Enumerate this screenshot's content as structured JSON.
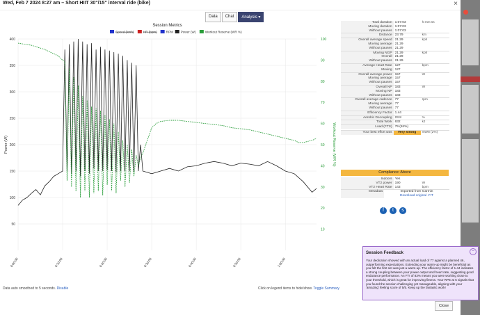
{
  "window": {
    "title": "Wed, Feb 7 2024 8:27 am – Short HIIT 30\"/15\" interval ride (bike)",
    "close_glyph": "×",
    "tabs": [
      {
        "label": "Data",
        "active": false
      },
      {
        "label": "Chat",
        "active": false
      },
      {
        "label": "Analysis ▾",
        "active": true
      }
    ]
  },
  "chart_data": {
    "type": "line",
    "title": "Session Metrics",
    "legend": [
      {
        "name": "Speed (kmh)",
        "color": "#2233cc",
        "hidden": true
      },
      {
        "name": "HR (bpm)",
        "color": "#cc2222",
        "hidden": true
      },
      {
        "name": "RPM",
        "color": "#2233cc",
        "hidden": false
      },
      {
        "name": "Power (W)",
        "color": "#222222",
        "hidden": false
      },
      {
        "name": "Workout Reserve (WR %)",
        "color": "#2a9d3a",
        "hidden": false
      }
    ],
    "legend_placement": "top",
    "ylabel_left": "Power (W)",
    "ylabel_right": "Workout Reserve (WR %)",
    "ylim_left": [
      0,
      400
    ],
    "ylim_right": [
      0,
      100
    ],
    "yticks_left": [
      50,
      100,
      150,
      200,
      250,
      300,
      350,
      400
    ],
    "yticks_right": [
      10,
      20,
      30,
      40,
      50,
      60,
      70,
      80,
      90,
      100
    ],
    "xticks": [
      "0:00:00",
      "0:10:00",
      "0:20:00",
      "0:30:00",
      "0:40:00",
      "0:50:00",
      "1:00:00"
    ],
    "xlim_minutes": [
      0,
      67
    ],
    "grid": true,
    "series": [
      {
        "name": "Power (W)",
        "x": [
          0,
          1,
          2,
          3,
          4,
          5,
          6,
          7,
          8,
          9,
          10,
          10.5,
          11,
          11.5,
          12,
          12.5,
          13,
          13.5,
          14,
          14.5,
          15,
          15.5,
          16,
          16.5,
          17,
          17.5,
          18,
          18.5,
          19,
          19.5,
          20,
          20.5,
          21,
          21.5,
          22,
          22.5,
          23,
          23.5,
          24,
          24.5,
          25,
          25.5,
          26,
          26.5,
          27,
          27.5,
          28,
          30,
          32,
          34,
          36,
          38,
          40,
          42,
          44,
          46,
          48,
          50,
          52,
          54,
          56,
          58,
          60,
          62,
          64,
          66,
          67
        ],
        "values": [
          85,
          95,
          100,
          108,
          115,
          105,
          122,
          130,
          140,
          145,
          150,
          380,
          150,
          390,
          145,
          395,
          150,
          400,
          140,
          395,
          150,
          390,
          145,
          392,
          155,
          380,
          150,
          385,
          150,
          380,
          152,
          378,
          150,
          375,
          148,
          372,
          150,
          368,
          150,
          360,
          150,
          355,
          148,
          350,
          150,
          200,
          150,
          145,
          150,
          155,
          150,
          158,
          160,
          165,
          168,
          165,
          160,
          165,
          163,
          160,
          168,
          160,
          150,
          145,
          130,
          110,
          117
        ]
      },
      {
        "name": "Workout Reserve (WR %)",
        "x": [
          0,
          3,
          6,
          9,
          10,
          10.5,
          11,
          11.5,
          12,
          12.5,
          13,
          13.5,
          14,
          14.5,
          15,
          15.5,
          16,
          16.5,
          17,
          17.5,
          18,
          18.5,
          19,
          19.5,
          20,
          20.5,
          21,
          21.5,
          22,
          22.5,
          23,
          23.5,
          24,
          24.5,
          25,
          25.5,
          26,
          26.5,
          27,
          27.5,
          28,
          29,
          30,
          31,
          32,
          34,
          36,
          38,
          40,
          42,
          44,
          46,
          48,
          50,
          52,
          54,
          56,
          58,
          60,
          62,
          63,
          64,
          66,
          67
        ],
        "values": [
          98,
          97,
          95,
          92,
          90,
          89,
          33,
          86,
          30,
          82,
          28,
          78,
          25,
          73,
          28,
          71,
          25,
          68,
          27,
          67,
          28,
          66,
          26,
          64,
          31,
          62,
          28,
          60,
          27,
          56,
          33,
          52,
          30,
          50,
          32,
          48,
          35,
          45,
          40,
          44,
          46,
          52,
          58,
          60,
          61,
          61.5,
          61.5,
          61,
          60.5,
          60,
          59.5,
          59,
          58,
          57.5,
          57,
          56,
          55,
          54,
          53,
          52,
          51,
          51,
          52,
          53
        ]
      }
    ]
  },
  "footnote": {
    "text": "Data auto smoothed to 5 seconds.",
    "link": "Disable"
  },
  "toggle_hint": {
    "text": "Click on legend items to hide/show.",
    "link": "Toggle Summary"
  },
  "metrics": {
    "rows": [
      {
        "label": "Total duration",
        "value": "1:07:03",
        "unit": "h:mm:ss"
      },
      {
        "label": "Moving duration",
        "value": "1:07:03",
        "unit": ""
      },
      {
        "label": "Without pauses",
        "value": "1:07:03",
        "unit": ""
      },
      {
        "label": "Distance",
        "value": "23.79",
        "unit": "km",
        "sep": true
      },
      {
        "label": "Overall average speed",
        "value": "21.29",
        "unit": "kph",
        "sep": true
      },
      {
        "label": "Moving average",
        "value": "21.29",
        "unit": ""
      },
      {
        "label": "Without pauses",
        "value": "21.29",
        "unit": ""
      },
      {
        "label": "Moving NGP",
        "value": "21.29",
        "unit": "kph",
        "sep": true
      },
      {
        "label": "Overall",
        "value": "21.29",
        "unit": ""
      },
      {
        "label": "Without pauses",
        "value": "21.29",
        "unit": ""
      },
      {
        "label": "Average Heart Rate",
        "value": "127",
        "unit": "bpm",
        "sep": true
      },
      {
        "label": "Moving",
        "value": "127",
        "unit": ""
      },
      {
        "label": "Overall average power",
        "value": "157",
        "unit": "W",
        "sep": true
      },
      {
        "label": "Moving average",
        "value": "157",
        "unit": ""
      },
      {
        "label": "Without pauses",
        "value": "157",
        "unit": ""
      },
      {
        "label": "Overall NP",
        "value": "183",
        "unit": "W",
        "sep": true
      },
      {
        "label": "Moving NP",
        "value": "183",
        "unit": ""
      },
      {
        "label": "Without pauses",
        "value": "183",
        "unit": ""
      },
      {
        "label": "Overall average cadence",
        "value": "77",
        "unit": "rpm",
        "sep": true
      },
      {
        "label": "Moving average",
        "value": "77",
        "unit": ""
      },
      {
        "label": "Without pauses",
        "value": "77",
        "unit": ""
      },
      {
        "label": "Efficiency Factor",
        "value": "1.44",
        "unit": "",
        "sep": true
      },
      {
        "label": "Aerobic Decoupling",
        "value": "23.8",
        "unit": "%",
        "sep": true
      },
      {
        "label": "Total Work",
        "value": "632",
        "unit": "kJ",
        "sep": true
      },
      {
        "label": "Load (FTS)",
        "value": "79 (84%)",
        "unit": "",
        "sep": true
      }
    ],
    "best_effort_label": "Your best effort was",
    "best_effort_value": "Very strong",
    "best_effort_extra": "mW8 (2%)",
    "compliance": "Compliance: Above",
    "rows2": [
      {
        "label": "Indoors",
        "value": "Yes",
        "unit": ""
      },
      {
        "label": "VT2 power",
        "value": "190",
        "unit": "W"
      },
      {
        "label": "VT2 Heart Rate",
        "value": "143",
        "unit": "bpm"
      }
    ],
    "metadata_label": "Metadata",
    "metadata_value": "Imported from Garmin",
    "metadata_link": "Download original .FIT"
  },
  "social": [
    "f",
    "t",
    "s"
  ],
  "close_button": "Close",
  "feedback": {
    "title": "Session Feedback",
    "minimize_glyph": "–",
    "text": "Your dedication showed with an actual load of 77 against a planned 46, outperforming expectations. Extending your warm-up might be beneficial as you felt the first set was just a warm-up. The efficiency factor of 1.44 indicates a strong coupling between your power output and heart rate, suggesting good endurance performance. An FTI of 83% means you were working close to your threshold, which is great for improving fitness. Your RPE at 5 signals that you found the session challenging yet manageable, aligning with your 'amazing' feeling score of 5/5. Keep up the fantastic work!"
  },
  "colors": {
    "accent": "#3a4470",
    "orange": "#f4b740",
    "power": "#222222",
    "wr": "#2a9d3a",
    "feedback_bg": "#efe3fb"
  }
}
